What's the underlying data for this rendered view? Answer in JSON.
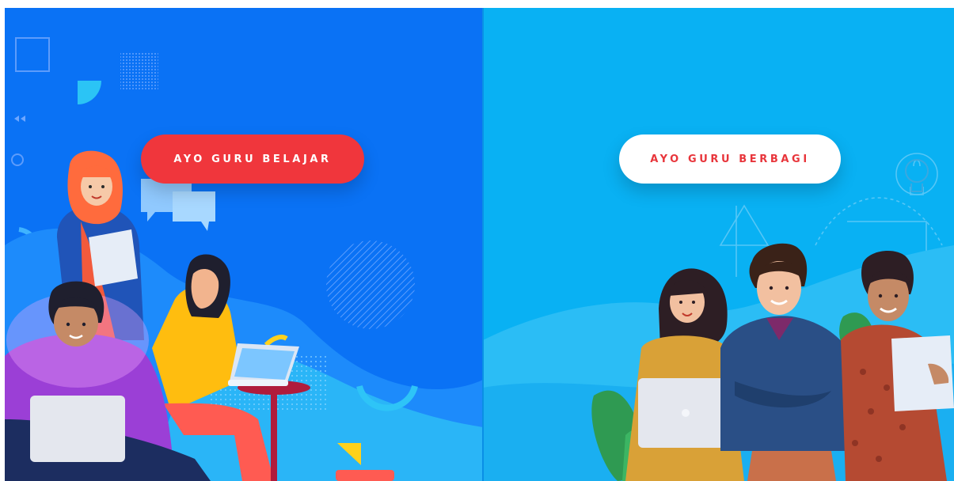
{
  "left_panel": {
    "button_label": "AYO GURU BELAJAR",
    "background": "#0a72f5",
    "button_color": "#f0363c"
  },
  "right_panel": {
    "button_label": "AYO GURU BERBAGI",
    "background": "#09b1f3",
    "button_text_color": "#e8353b"
  }
}
